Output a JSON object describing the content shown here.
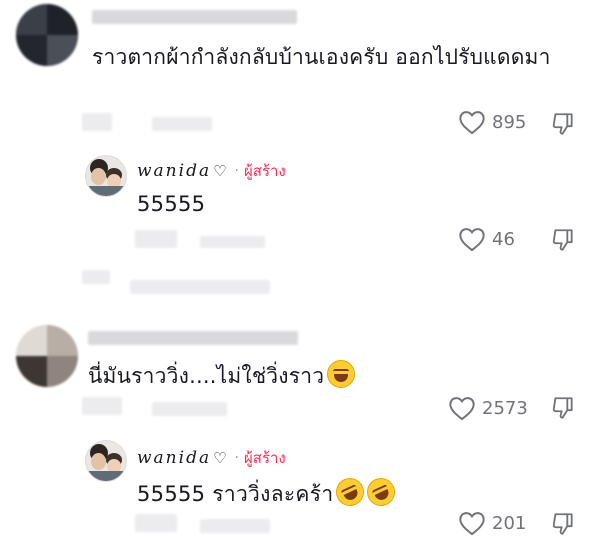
{
  "comments": [
    {
      "text": "ราวตากผ้ากำลังกลับบ้านเองครับ ออกไปรับแดดมา",
      "likes": "895",
      "reply": {
        "username": "wanida",
        "heart": "♡",
        "separator": "·",
        "creator_label": "ผู้สร้าง",
        "text": "55555",
        "likes": "46"
      }
    },
    {
      "text": "นี่มันราววิ่ง....ไม่ใช่วิ่งราว",
      "emoji": "laughing-emoji",
      "likes": "2573",
      "reply": {
        "username": "wanida",
        "heart": "♡",
        "separator": "·",
        "creator_label": "ผู้สร้าง",
        "text": "55555 ราววิ่งละคร้า",
        "emoji": "rofl-emoji",
        "likes": "201"
      }
    }
  ],
  "colors": {
    "creator_accent": "#fe2c55",
    "muted": "#70737a",
    "text": "#161823"
  }
}
